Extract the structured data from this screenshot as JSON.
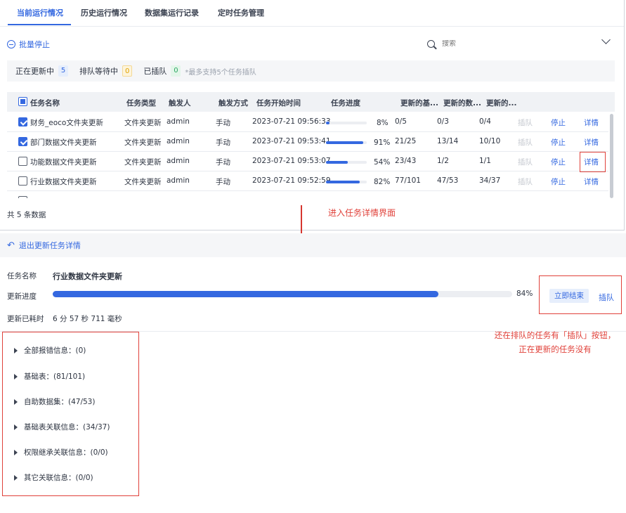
{
  "tabs": [
    {
      "label": "当前运行情况",
      "active": true
    },
    {
      "label": "历史运行情况"
    },
    {
      "label": "数据集运行记录"
    },
    {
      "label": "定时任务管理"
    }
  ],
  "toolbar": {
    "batch_stop": "批量停止"
  },
  "search": {
    "placeholder": "搜索"
  },
  "status": {
    "updating_label": "正在更新中",
    "updating_count": "5",
    "waiting_label": "排队等待中",
    "waiting_count": "0",
    "inserted_label": "已插队",
    "inserted_count": "0",
    "note": "*最多支持5个任务插队"
  },
  "table": {
    "headers": [
      "任务名称",
      "任务类型",
      "触发人",
      "触发方式",
      "任务开始时间",
      "任务进度",
      "更新的基...",
      "更新的数...",
      "更新的..."
    ],
    "rows": [
      {
        "name": "财务_eoco文件夹更新",
        "type": "文件夹更新",
        "user": "admin",
        "trigger": "手动",
        "start": "2023-07-21 09:56:33",
        "progress": 8,
        "progress_text": "8%",
        "base": "0/5",
        "data": "0/3",
        "other": "0/4",
        "queue": "插队",
        "stop": "停止",
        "detail": "详情",
        "checked": true
      },
      {
        "name": "部门数据文件夹更新",
        "type": "文件夹更新",
        "user": "admin",
        "trigger": "手动",
        "start": "2023-07-21 09:53:41",
        "progress": 91,
        "progress_text": "91%",
        "base": "21/25",
        "data": "13/14",
        "other": "10/10",
        "queue": "插队",
        "stop": "停止",
        "detail": "详情",
        "checked": true
      },
      {
        "name": "功能数据文件夹更新",
        "type": "文件夹更新",
        "user": "admin",
        "trigger": "手动",
        "start": "2023-07-21 09:53:07",
        "progress": 54,
        "progress_text": "54%",
        "base": "23/43",
        "data": "1/2",
        "other": "1/1",
        "queue": "插队",
        "stop": "停止",
        "detail": "详情",
        "checked": false
      },
      {
        "name": "行业数据文件夹更新",
        "type": "文件夹更新",
        "user": "admin",
        "trigger": "手动",
        "start": "2023-07-21 09:52:59",
        "progress": 82,
        "progress_text": "82%",
        "base": "77/101",
        "data": "47/53",
        "other": "34/37",
        "queue": "插队",
        "stop": "停止",
        "detail": "详情",
        "checked": false
      }
    ],
    "total": "共 5 条数据"
  },
  "annotation_enter": "进入任务详情界面",
  "detail": {
    "back": "退出更新任务详情",
    "task_name_label": "任务名称",
    "task_name": "行业数据文件夹更新",
    "progress_label": "更新进度",
    "progress": 84,
    "progress_text": "84%",
    "end_button": "立即结束",
    "queue_button": "插队",
    "elapsed_label": "更新已耗时",
    "elapsed": "6 分 57 秒 711 毫秒",
    "sections": [
      "全部报错信息：(0)",
      "基础表：(81/101)",
      "自助数据集：(47/53)",
      "基础表关联信息：(34/37)",
      "权限继承关联信息：(0/0)",
      "其它关联信息：(0/0)"
    ]
  },
  "annotation_queue": "还在排队的任务有「插队」按钮，正在更新的任务没有",
  "colors": {
    "accent": "#3468e0",
    "annotation": "#e0413a"
  }
}
